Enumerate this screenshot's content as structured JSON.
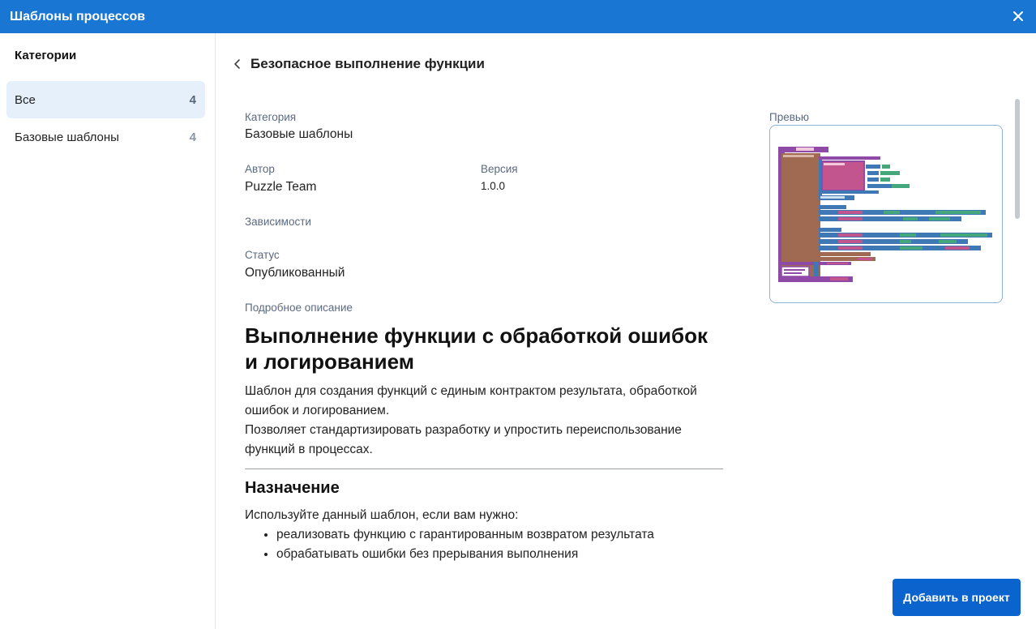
{
  "window": {
    "title": "Шаблоны процессов"
  },
  "sidebar": {
    "heading": "Категории",
    "items": [
      {
        "label": "Все",
        "count": "4"
      },
      {
        "label": "Базовые шаблоны",
        "count": "4"
      }
    ]
  },
  "detail": {
    "title": "Безопасное выполнение функции",
    "fields": {
      "category_label": "Категория",
      "category_value": "Базовые шаблоны",
      "author_label": "Автор",
      "author_value": "Puzzle Team",
      "version_label": "Версия",
      "version_value": "1.0.0",
      "dependencies_label": "Зависимости",
      "status_label": "Статус",
      "status_value": "Опубликованный",
      "description_label": "Подробное описание"
    },
    "description": {
      "heading": "Выполнение функции с обработкой ошибок и логированием",
      "para1": "Шаблон для создания функций с единым контрактом результата, обработкой ошибок и логированием.",
      "para2": "Позволяет стандартизировать разработку и упростить переиспользование функций в процессах.",
      "section_heading": "Назначение",
      "section_intro": "Используйте данный шаблон, если вам нужно:",
      "bullets": [
        "реализовать функцию с гарантированным возвратом результата",
        "обрабатывать ошибки без прерывания выполнения"
      ]
    },
    "preview_label": "Превью"
  },
  "actions": {
    "add_to_project": "Добавить в проект"
  },
  "colors": {
    "header": "#1976d2",
    "primary_button": "#0b63ce",
    "active_category": "#e6f0fb",
    "block_brown": "#a06a52",
    "block_purple": "#8e4aa6",
    "block_blue": "#3f79b5",
    "block_green": "#45a87c",
    "block_pink": "#c2548e"
  }
}
